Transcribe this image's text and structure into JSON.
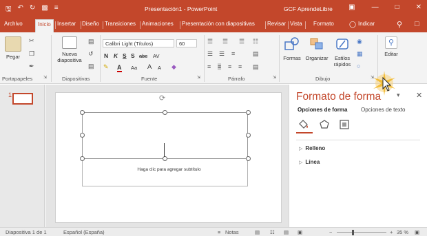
{
  "window": {
    "title": "Presentación1 - PowerPoint",
    "owner": "GCF AprendeLibre",
    "accent": "#c3472b"
  },
  "tabs": [
    {
      "label": "Archivo"
    },
    {
      "label": "Inicio",
      "active": true
    },
    {
      "label": "Insertar"
    },
    {
      "label": "Diseño"
    },
    {
      "label": "Transiciones"
    },
    {
      "label": "Animaciones"
    },
    {
      "label": "Presentación con diapositivas"
    },
    {
      "label": "Revisar"
    },
    {
      "label": "Vista"
    },
    {
      "label": "Formato"
    }
  ],
  "tell_me": "Indicar",
  "ribbon": {
    "paste_label": "Pegar",
    "new_slide_label_1": "Nueva",
    "new_slide_label_2": "diapositiva",
    "font_name": "Calibri Light (Títulos)",
    "font_size": "60",
    "bold": "N",
    "italic": "K",
    "underline": "S",
    "strike": "S",
    "abc": "abc",
    "font_spacing": "AV",
    "font_color": "A",
    "change_case": "Aa",
    "grow_font": "A",
    "shrink_font": "A",
    "shapes_label": "Formas",
    "arrange_label": "Organizar",
    "quick_styles_label_1": "Estilos",
    "quick_styles_label_2": "rápidos",
    "edit_label": "Editar",
    "groups": {
      "clipboard": "Portapapeles",
      "slides": "Diapositivas",
      "font": "Fuente",
      "paragraph": "Párrafo",
      "drawing": "Dibujo"
    }
  },
  "slides": {
    "number": "1"
  },
  "canvas": {
    "subtitle_placeholder": "Haga clic para agregar subtítulo"
  },
  "format_pane": {
    "title": "Formato de forma",
    "tab_shape": "Opciones de forma",
    "tab_text": "Opciones de texto",
    "section_fill": "Relleno",
    "section_line": "Línea"
  },
  "status": {
    "slide_info": "Diapositiva 1 de 1",
    "language": "Español (España)",
    "notes": "Notas",
    "zoom": "35 %"
  }
}
